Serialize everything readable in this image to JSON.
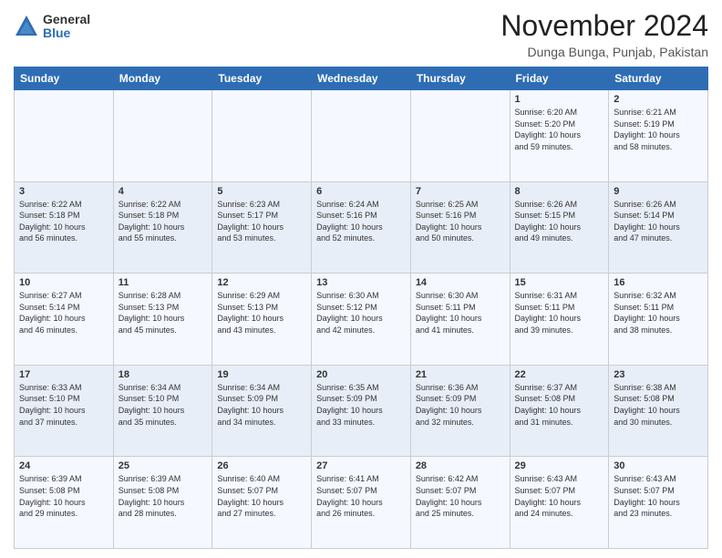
{
  "logo": {
    "general": "General",
    "blue": "Blue"
  },
  "header": {
    "month": "November 2024",
    "location": "Dunga Bunga, Punjab, Pakistan"
  },
  "weekdays": [
    "Sunday",
    "Monday",
    "Tuesday",
    "Wednesday",
    "Thursday",
    "Friday",
    "Saturday"
  ],
  "rows": [
    [
      {
        "day": "",
        "content": ""
      },
      {
        "day": "",
        "content": ""
      },
      {
        "day": "",
        "content": ""
      },
      {
        "day": "",
        "content": ""
      },
      {
        "day": "",
        "content": ""
      },
      {
        "day": "1",
        "content": "Sunrise: 6:20 AM\nSunset: 5:20 PM\nDaylight: 10 hours\nand 59 minutes."
      },
      {
        "day": "2",
        "content": "Sunrise: 6:21 AM\nSunset: 5:19 PM\nDaylight: 10 hours\nand 58 minutes."
      }
    ],
    [
      {
        "day": "3",
        "content": "Sunrise: 6:22 AM\nSunset: 5:18 PM\nDaylight: 10 hours\nand 56 minutes."
      },
      {
        "day": "4",
        "content": "Sunrise: 6:22 AM\nSunset: 5:18 PM\nDaylight: 10 hours\nand 55 minutes."
      },
      {
        "day": "5",
        "content": "Sunrise: 6:23 AM\nSunset: 5:17 PM\nDaylight: 10 hours\nand 53 minutes."
      },
      {
        "day": "6",
        "content": "Sunrise: 6:24 AM\nSunset: 5:16 PM\nDaylight: 10 hours\nand 52 minutes."
      },
      {
        "day": "7",
        "content": "Sunrise: 6:25 AM\nSunset: 5:16 PM\nDaylight: 10 hours\nand 50 minutes."
      },
      {
        "day": "8",
        "content": "Sunrise: 6:26 AM\nSunset: 5:15 PM\nDaylight: 10 hours\nand 49 minutes."
      },
      {
        "day": "9",
        "content": "Sunrise: 6:26 AM\nSunset: 5:14 PM\nDaylight: 10 hours\nand 47 minutes."
      }
    ],
    [
      {
        "day": "10",
        "content": "Sunrise: 6:27 AM\nSunset: 5:14 PM\nDaylight: 10 hours\nand 46 minutes."
      },
      {
        "day": "11",
        "content": "Sunrise: 6:28 AM\nSunset: 5:13 PM\nDaylight: 10 hours\nand 45 minutes."
      },
      {
        "day": "12",
        "content": "Sunrise: 6:29 AM\nSunset: 5:13 PM\nDaylight: 10 hours\nand 43 minutes."
      },
      {
        "day": "13",
        "content": "Sunrise: 6:30 AM\nSunset: 5:12 PM\nDaylight: 10 hours\nand 42 minutes."
      },
      {
        "day": "14",
        "content": "Sunrise: 6:30 AM\nSunset: 5:11 PM\nDaylight: 10 hours\nand 41 minutes."
      },
      {
        "day": "15",
        "content": "Sunrise: 6:31 AM\nSunset: 5:11 PM\nDaylight: 10 hours\nand 39 minutes."
      },
      {
        "day": "16",
        "content": "Sunrise: 6:32 AM\nSunset: 5:11 PM\nDaylight: 10 hours\nand 38 minutes."
      }
    ],
    [
      {
        "day": "17",
        "content": "Sunrise: 6:33 AM\nSunset: 5:10 PM\nDaylight: 10 hours\nand 37 minutes."
      },
      {
        "day": "18",
        "content": "Sunrise: 6:34 AM\nSunset: 5:10 PM\nDaylight: 10 hours\nand 35 minutes."
      },
      {
        "day": "19",
        "content": "Sunrise: 6:34 AM\nSunset: 5:09 PM\nDaylight: 10 hours\nand 34 minutes."
      },
      {
        "day": "20",
        "content": "Sunrise: 6:35 AM\nSunset: 5:09 PM\nDaylight: 10 hours\nand 33 minutes."
      },
      {
        "day": "21",
        "content": "Sunrise: 6:36 AM\nSunset: 5:09 PM\nDaylight: 10 hours\nand 32 minutes."
      },
      {
        "day": "22",
        "content": "Sunrise: 6:37 AM\nSunset: 5:08 PM\nDaylight: 10 hours\nand 31 minutes."
      },
      {
        "day": "23",
        "content": "Sunrise: 6:38 AM\nSunset: 5:08 PM\nDaylight: 10 hours\nand 30 minutes."
      }
    ],
    [
      {
        "day": "24",
        "content": "Sunrise: 6:39 AM\nSunset: 5:08 PM\nDaylight: 10 hours\nand 29 minutes."
      },
      {
        "day": "25",
        "content": "Sunrise: 6:39 AM\nSunset: 5:08 PM\nDaylight: 10 hours\nand 28 minutes."
      },
      {
        "day": "26",
        "content": "Sunrise: 6:40 AM\nSunset: 5:07 PM\nDaylight: 10 hours\nand 27 minutes."
      },
      {
        "day": "27",
        "content": "Sunrise: 6:41 AM\nSunset: 5:07 PM\nDaylight: 10 hours\nand 26 minutes."
      },
      {
        "day": "28",
        "content": "Sunrise: 6:42 AM\nSunset: 5:07 PM\nDaylight: 10 hours\nand 25 minutes."
      },
      {
        "day": "29",
        "content": "Sunrise: 6:43 AM\nSunset: 5:07 PM\nDaylight: 10 hours\nand 24 minutes."
      },
      {
        "day": "30",
        "content": "Sunrise: 6:43 AM\nSunset: 5:07 PM\nDaylight: 10 hours\nand 23 minutes."
      }
    ]
  ]
}
